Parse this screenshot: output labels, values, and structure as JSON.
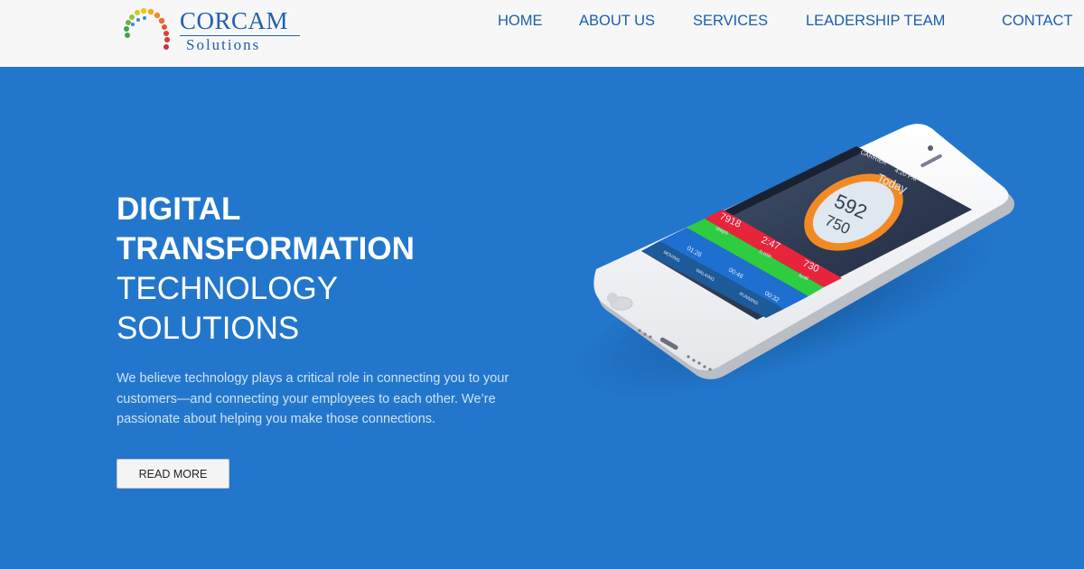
{
  "header": {
    "logo": {
      "title": "CORCAM",
      "subtitle": "Solutions"
    },
    "nav": [
      {
        "label": "HOME"
      },
      {
        "label": "ABOUT US"
      },
      {
        "label": "SERVICES"
      },
      {
        "label": "LEADERSHIP TEAM"
      },
      {
        "label": "CONTACT"
      }
    ]
  },
  "hero": {
    "title_bold": [
      "DIGITAL",
      "TRANSFORMATION"
    ],
    "title_light": [
      "TECHNOLOGY",
      "SOLUTIONS"
    ],
    "description": "We believe technology plays a critical role in connecting you to your customers—and connecting your employees to each other. We’re passionate about helping you make those connections.",
    "cta_label": "READ MORE"
  },
  "phone_screen": {
    "carrier": "CARRIER",
    "time": "4:20 PM",
    "header": "Today",
    "ring_value": "592",
    "ring_goal": "750",
    "stats": [
      {
        "value": "7918",
        "unit": "steps"
      },
      {
        "value": "2:47",
        "unit": "h:min"
      },
      {
        "value": "730",
        "unit": "kcal"
      }
    ],
    "activities": [
      {
        "label": "MOVING",
        "time": "01:26"
      },
      {
        "label": "WALKING",
        "time": "00:46"
      },
      {
        "label": "RUNNING",
        "time": "00:32"
      }
    ]
  },
  "colors": {
    "background": "#2277cc",
    "header_bg": "#f7f7f7",
    "nav_text": "#1a5eb1",
    "logo_text": "#1f5fb0"
  }
}
